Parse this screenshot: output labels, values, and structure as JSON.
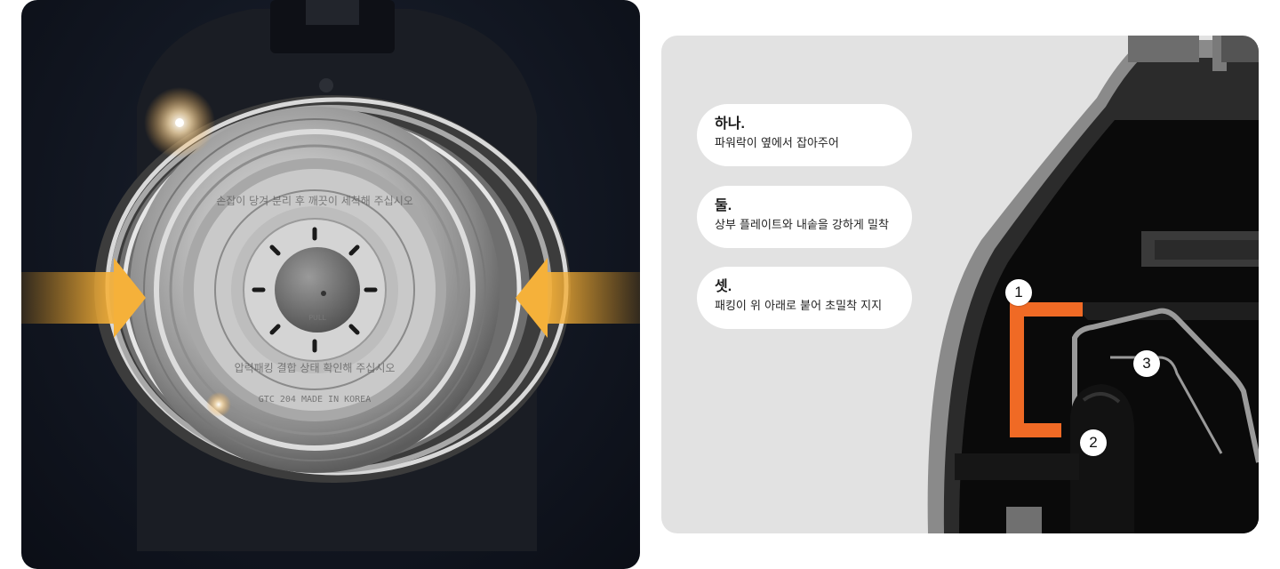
{
  "steps": [
    {
      "title": "하나.",
      "desc": "파워락이 옆에서 잡아주어"
    },
    {
      "title": "둘.",
      "desc": "상부 플레이트와 내솥을 강하게 밀착"
    },
    {
      "title": "셋.",
      "desc": "패킹이 위 아래로 붙어 초밀착 지지"
    }
  ],
  "callouts": [
    "1",
    "2",
    "3"
  ],
  "lid_engraving": {
    "top_ring": "손잡이 당겨 분리 후 깨끗이 세척해 주십시오",
    "bottom_ring": "압력패킹 결합 상태 확인해 주십시오",
    "model_text": "GTC 204  MADE IN KOREA",
    "center_mark": "PULL"
  },
  "colors": {
    "arrow": "#f5a623",
    "highlight_part": "#f06a25",
    "background_right": "#e2e2e2",
    "background_left": "#121722"
  },
  "icons": [
    "arrow-right-icon",
    "arrow-left-icon"
  ]
}
